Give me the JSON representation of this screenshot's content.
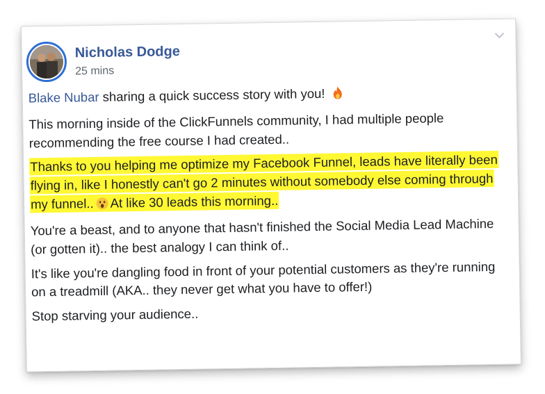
{
  "post": {
    "author": "Nicholas Dodge",
    "timestamp": "25 mins",
    "mention": "Blake Nubar",
    "intro": " sharing a quick success story with you! ",
    "paragraph_1": "This morning inside of the ClickFunnels community, I had multiple people recommending the free course I had created..",
    "highlight_before": "Thanks to you helping me optimize my Facebook Funnel, leads have literally been flying in, like I honestly can't go 2 minutes without somebody else coming through my funnel..",
    "highlight_after": "At like 30 leads this morning..",
    "paragraph_3": "You're a beast, and to anyone that hasn't finished the Social Media Lead Machine (or gotten it).. the best analogy I can think of..",
    "paragraph_4": "It's like you're dangling food in front of your potential customers as they're running on a treadmill (AKA.. they never get what you have to offer!)",
    "paragraph_5": "Stop starving your audience.."
  },
  "icons": {
    "fire": "fire-emoji-icon",
    "wow": "wow-emoji-icon",
    "menu": "chevron-down-icon"
  },
  "colors": {
    "name": "#385898",
    "mention": "#385898",
    "highlight": "#fff833",
    "avatar_ring": "#2d6fd6",
    "meta_text": "#606770"
  }
}
